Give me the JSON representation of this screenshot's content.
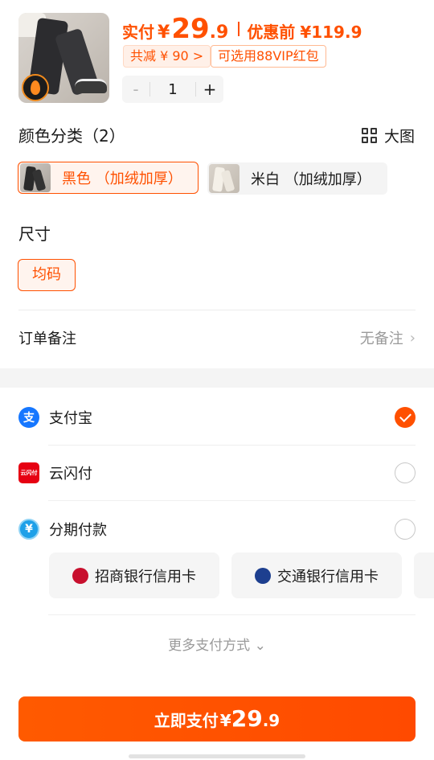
{
  "product": {
    "price_label": "实付",
    "currency": "¥",
    "price_int": "29",
    "price_dec": ".9",
    "original_label": "优惠前",
    "original_price": "¥119.9",
    "discount_tag": "共减 ¥ 90 >",
    "vip_tag": "可选用88VIP红包",
    "quantity": "1",
    "minus": "-",
    "plus": "+"
  },
  "color_section": {
    "title": "颜色分类（2）",
    "big_view_label": "大图",
    "options": [
      {
        "label": "黑色 （加绒加厚）",
        "selected": true
      },
      {
        "label": "米白 （加绒加厚）",
        "selected": false
      }
    ]
  },
  "size_section": {
    "title": "尺寸",
    "options": [
      {
        "label": "均码",
        "selected": true
      }
    ]
  },
  "remark": {
    "label": "订单备注",
    "value": "无备注",
    "chevron": "›"
  },
  "payment": {
    "methods": [
      {
        "label": "支付宝",
        "icon": "alipay-icon",
        "icon_text": "支",
        "checked": true
      },
      {
        "label": "云闪付",
        "icon": "unionpay-quickpass-icon",
        "icon_text": "云闪付",
        "checked": false
      },
      {
        "label": "分期付款",
        "icon": "installment-icon",
        "icon_text": "¥",
        "checked": false
      }
    ],
    "banks": [
      {
        "label": "招商银行信用卡",
        "icon": "cmb-icon"
      },
      {
        "label": "交通银行信用卡",
        "icon": "bocom-icon"
      }
    ],
    "more_label": "更多支付方式",
    "more_chevron": "⌄"
  },
  "pay_button": {
    "label": "立即支付",
    "currency": "¥",
    "amount_int": "29",
    "amount_dec": ".9"
  },
  "colors": {
    "accent": "#ff5000",
    "alipay": "#1677ff",
    "unionpay": "#e60012",
    "installment": "#1ea0e8"
  }
}
